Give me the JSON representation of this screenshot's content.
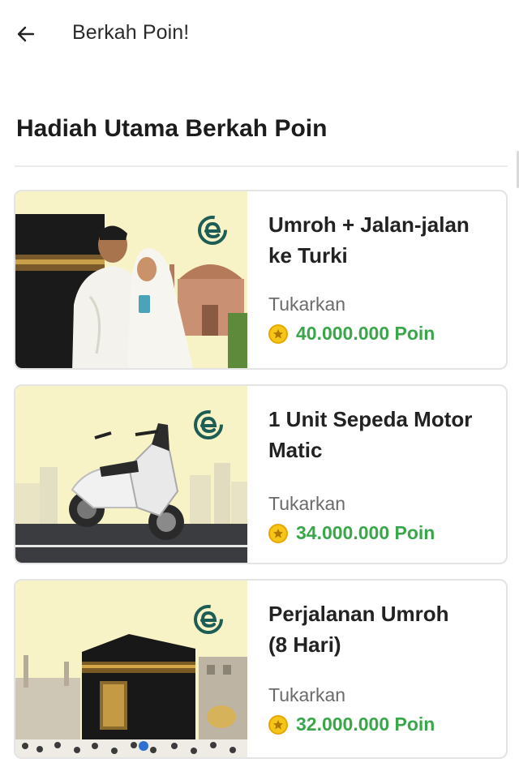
{
  "header": {
    "title": "Berkah Poin!",
    "back_icon": "arrow-left-icon"
  },
  "section": {
    "title": "Hadiah Utama Berkah Poin"
  },
  "rewards": [
    {
      "title_line1": "Umroh + Jalan-jalan",
      "title_line2": "ke Turki",
      "exchange_label": "Tukarkan",
      "points": "40.000.000 Poin",
      "image": "pilgrims-couple-kaaba-image"
    },
    {
      "title_line1": "1 Unit Sepeda Motor",
      "title_line2": "Matic",
      "exchange_label": "Tukarkan",
      "points": "34.000.000 Poin",
      "image": "scooter-image"
    },
    {
      "title_line1": "Perjalanan Umroh",
      "title_line2": "(8 Hari)",
      "exchange_label": "Tukarkan",
      "points": "32.000.000 Poin",
      "image": "kaaba-image"
    }
  ],
  "colors": {
    "points_green": "#3aa64a",
    "card_bg": "#f8f3c6",
    "logo_teal": "#1d5d55",
    "coin_yellow": "#f5c518"
  }
}
